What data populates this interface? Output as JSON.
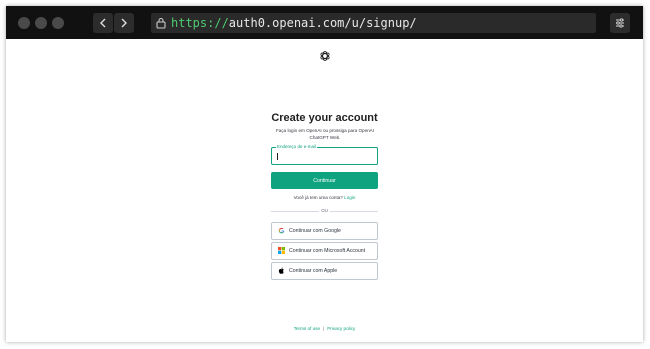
{
  "browser": {
    "url_protocol": "https://",
    "url_path": "auth0.openai.com/u/signup/"
  },
  "page": {
    "title": "Create your account",
    "subtitle": "Faça login em OpenAI ou prossiga para OpenAI ChatGPT Web.",
    "email_label": "Endereço de e-mail",
    "email_value": "",
    "continue_label": "Continuar",
    "have_account_text": "Você já tem uma conta?",
    "login_link": "Login",
    "or_text": "OU",
    "social": {
      "google": "Continuar com Google",
      "microsoft": "Continuar com Microsoft Account",
      "apple": "Continuar com Apple"
    }
  },
  "footer": {
    "terms": "Terms of use",
    "separator": "|",
    "privacy": "Privacy policy"
  },
  "colors": {
    "accent": "#10a37f",
    "browser_bar": "#111111",
    "url_protocol": "#4ecb71"
  },
  "icons": [
    "back-arrow-icon",
    "forward-arrow-icon",
    "lock-icon",
    "settings-sliders-icon",
    "openai-logo-icon",
    "google-icon",
    "microsoft-icon",
    "apple-icon"
  ]
}
